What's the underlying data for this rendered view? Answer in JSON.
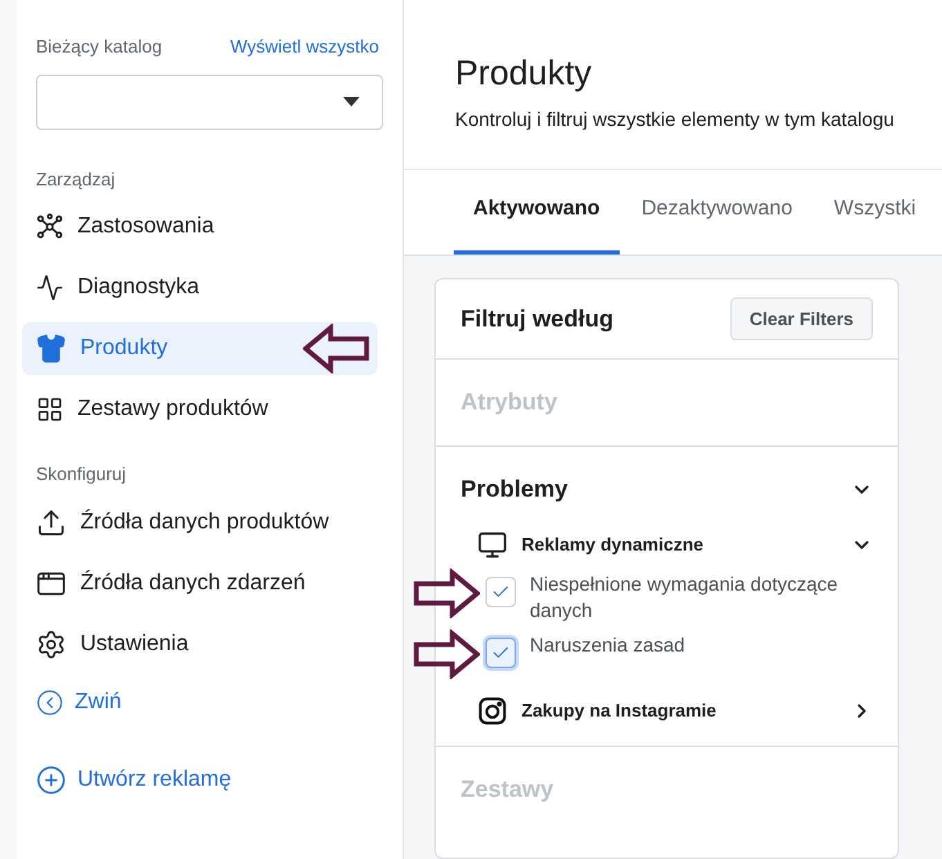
{
  "sidebar": {
    "catalog_label": "Bieżący katalog",
    "view_all_link": "Wyświetl wszystko",
    "sections": [
      {
        "title": "Zarządzaj",
        "items": [
          {
            "label": "Zastosowania",
            "selected": false
          },
          {
            "label": "Diagnostyka",
            "selected": false
          },
          {
            "label": "Produkty",
            "selected": true
          },
          {
            "label": "Zestawy produktów",
            "selected": false
          }
        ]
      },
      {
        "title": "Skonfiguruj",
        "items": [
          {
            "label": "Źródła danych produktów",
            "selected": false
          },
          {
            "label": "Źródła danych zdarzeń",
            "selected": false
          },
          {
            "label": "Ustawienia",
            "selected": false
          }
        ]
      }
    ],
    "collapse": "Zwiń",
    "create_ad": "Utwórz reklamę"
  },
  "header": {
    "title": "Produkty",
    "subtitle": "Kontroluj i filtruj wszystkie elementy w tym katalogu"
  },
  "tabs": [
    {
      "label": "Aktywowano",
      "selected": true
    },
    {
      "label": "Dezaktywowano",
      "selected": false
    },
    {
      "label": "Wszystki",
      "selected": false
    }
  ],
  "filters": {
    "title": "Filtruj według",
    "clear_button": "Clear Filters",
    "sections": [
      {
        "title": "Atrybuty",
        "disabled": true,
        "expanded": false
      },
      {
        "title": "Problemy",
        "disabled": false,
        "expanded": true,
        "groups": [
          {
            "title": "Reklamy dynamiczne",
            "expanded": true,
            "options": [
              {
                "label": "Niespełnione wymagania dotyczące danych",
                "checked": true,
                "focused": false
              },
              {
                "label": "Naruszenia zasad",
                "checked": true,
                "focused": true
              }
            ]
          },
          {
            "title": "Zakupy na Instagramie",
            "expanded": false
          }
        ]
      },
      {
        "title": "Zestawy",
        "disabled": true,
        "expanded": false
      }
    ]
  }
}
